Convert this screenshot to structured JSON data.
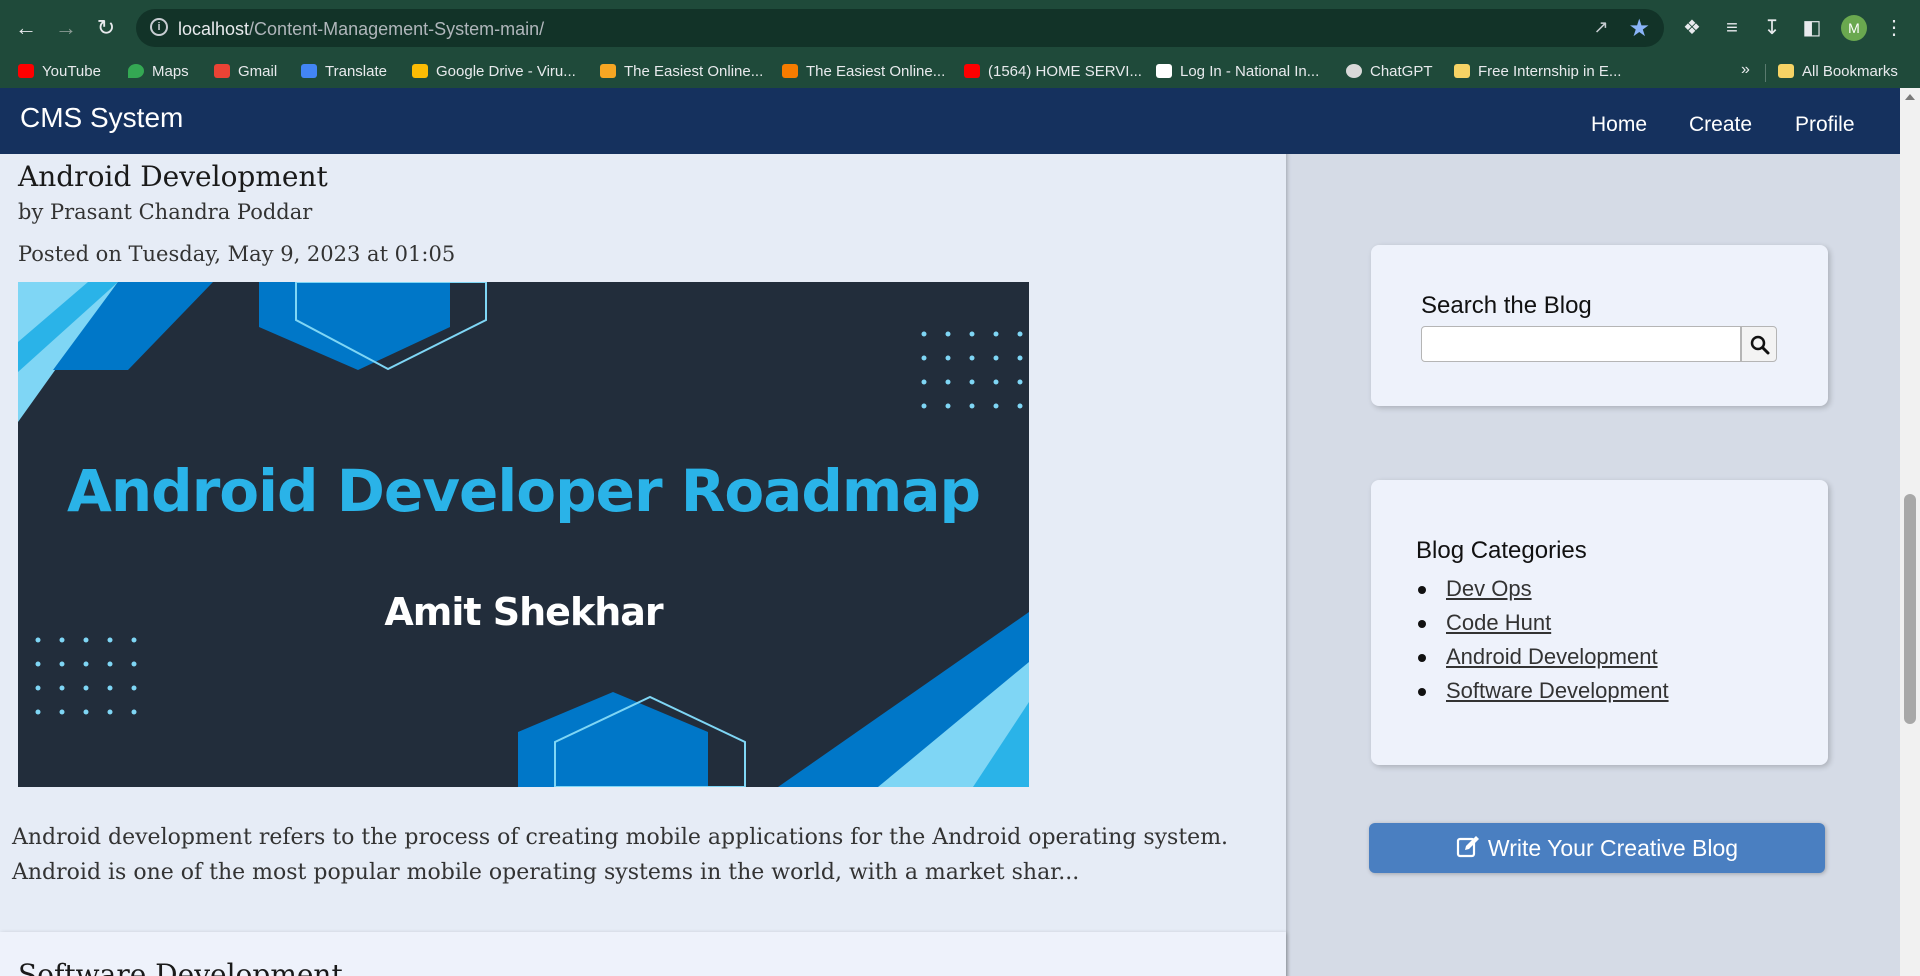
{
  "browser": {
    "url_host": "localhost",
    "url_path": "/Content-Management-System-main/",
    "avatar_letter": "M",
    "bookmarks": [
      {
        "label": "YouTube",
        "icon": "youtube-icon",
        "color": "#ff0000"
      },
      {
        "label": "Maps",
        "icon": "maps-icon",
        "color": "#34a853"
      },
      {
        "label": "Gmail",
        "icon": "gmail-icon",
        "color": "#ea4335"
      },
      {
        "label": "Translate",
        "icon": "translate-icon",
        "color": "#4285f4"
      },
      {
        "label": "Google Drive - Viru...",
        "icon": "drive-icon",
        "color": "#fbbc04"
      },
      {
        "label": "The Easiest Online...",
        "icon": "pencil-icon",
        "color": "#f6a623"
      },
      {
        "label": "The Easiest Online...",
        "icon": "clock-icon",
        "color": "#f57c00"
      },
      {
        "label": "(1564) HOME SERVI...",
        "icon": "youtube-icon",
        "color": "#ff0000"
      },
      {
        "label": "Log In - National In...",
        "icon": "ni-icon",
        "color": "#ffffff"
      },
      {
        "label": "ChatGPT",
        "icon": "chatgpt-icon",
        "color": "#d9d9d9"
      },
      {
        "label": "Free Internship in E...",
        "icon": "folder-icon",
        "color": "#f6d365"
      }
    ],
    "more_label": "»",
    "all_bookmarks_label": "All Bookmarks"
  },
  "navbar": {
    "brand": "CMS System",
    "links": [
      "Home",
      "Create",
      "Profile"
    ]
  },
  "post": {
    "title": "Android Development",
    "author": "by Prasant Chandra Poddar",
    "date": "Posted on Tuesday, May 9, 2023 at 01:05",
    "image_title": "Android Developer Roadmap",
    "image_subtitle": "Amit Shekhar",
    "excerpt": "Android development refers to the process of creating mobile applications for the Android operating system. Android is one of the most popular mobile operating systems in the world, with a market shar..."
  },
  "next_post": {
    "title": "Software Development"
  },
  "sidebar": {
    "search_title": "Search the Blog",
    "search_value": "",
    "categories_title": "Blog Categories",
    "categories": [
      "Dev Ops",
      "Code Hunt",
      "Android Development",
      "Software Development"
    ],
    "write_button": "Write Your Creative Blog"
  },
  "colors": {
    "navbar_bg": "#15315e",
    "button_bg": "#4a7fc1",
    "image_title_color": "#2ab3e8",
    "browser_chrome": "#1f4a3a"
  }
}
